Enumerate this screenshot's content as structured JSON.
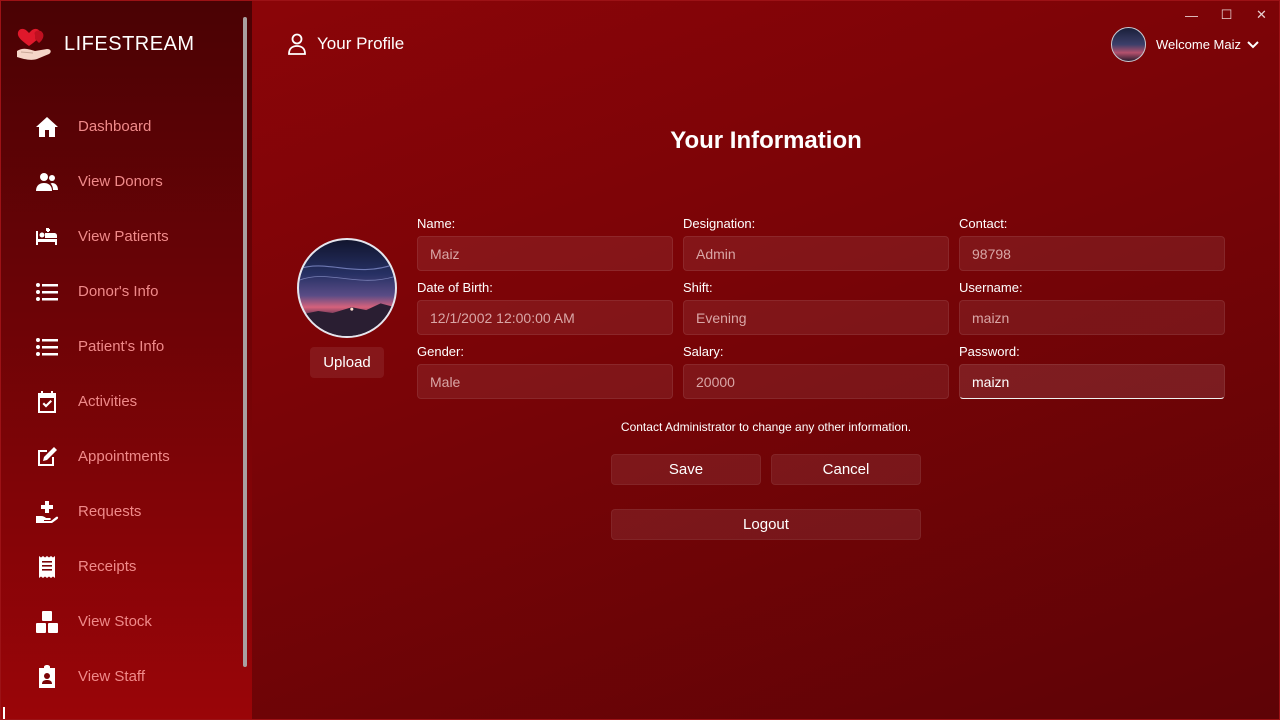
{
  "app": {
    "name": "LIFESTREAM"
  },
  "header": {
    "title": "Your Profile",
    "welcome": "Welcome Maiz"
  },
  "window_controls": {
    "minimize": "—",
    "maximize": "☐",
    "close": "✕"
  },
  "sidebar": {
    "items": [
      {
        "label": "Dashboard",
        "icon": "home-icon"
      },
      {
        "label": "View Donors",
        "icon": "users-icon"
      },
      {
        "label": "View Patients",
        "icon": "bed-icon"
      },
      {
        "label": "Donor's Info",
        "icon": "list-icon"
      },
      {
        "label": "Patient's Info",
        "icon": "list-icon"
      },
      {
        "label": "Activities",
        "icon": "calendar-check-icon"
      },
      {
        "label": "Appointments",
        "icon": "edit-icon"
      },
      {
        "label": "Requests",
        "icon": "hand-plus-icon"
      },
      {
        "label": "Receipts",
        "icon": "receipt-icon"
      },
      {
        "label": "View Stock",
        "icon": "boxes-icon"
      },
      {
        "label": "View Staff",
        "icon": "id-badge-icon"
      }
    ]
  },
  "main": {
    "title": "Your Information",
    "upload_label": "Upload",
    "note": "Contact Administrator to change any other information.",
    "fields": {
      "name": {
        "label": "Name:",
        "value": "Maiz"
      },
      "designation": {
        "label": "Designation:",
        "value": "Admin"
      },
      "contact": {
        "label": "Contact:",
        "value": "98798"
      },
      "dob": {
        "label": "Date of Birth:",
        "value": "12/1/2002 12:00:00 AM"
      },
      "shift": {
        "label": "Shift:",
        "value": "Evening"
      },
      "username": {
        "label": "Username:",
        "value": "maizn"
      },
      "gender": {
        "label": "Gender:",
        "value": "Male"
      },
      "salary": {
        "label": "Salary:",
        "value": "20000"
      },
      "password": {
        "label": "Password:",
        "value": "maizn"
      }
    },
    "buttons": {
      "save": "Save",
      "cancel": "Cancel",
      "logout": "Logout"
    }
  },
  "colors": {
    "background": "#7a0407",
    "sidebar_top": "#4a0204",
    "sidebar_bottom": "#9a0508",
    "nav_label": "#f08a8a"
  }
}
